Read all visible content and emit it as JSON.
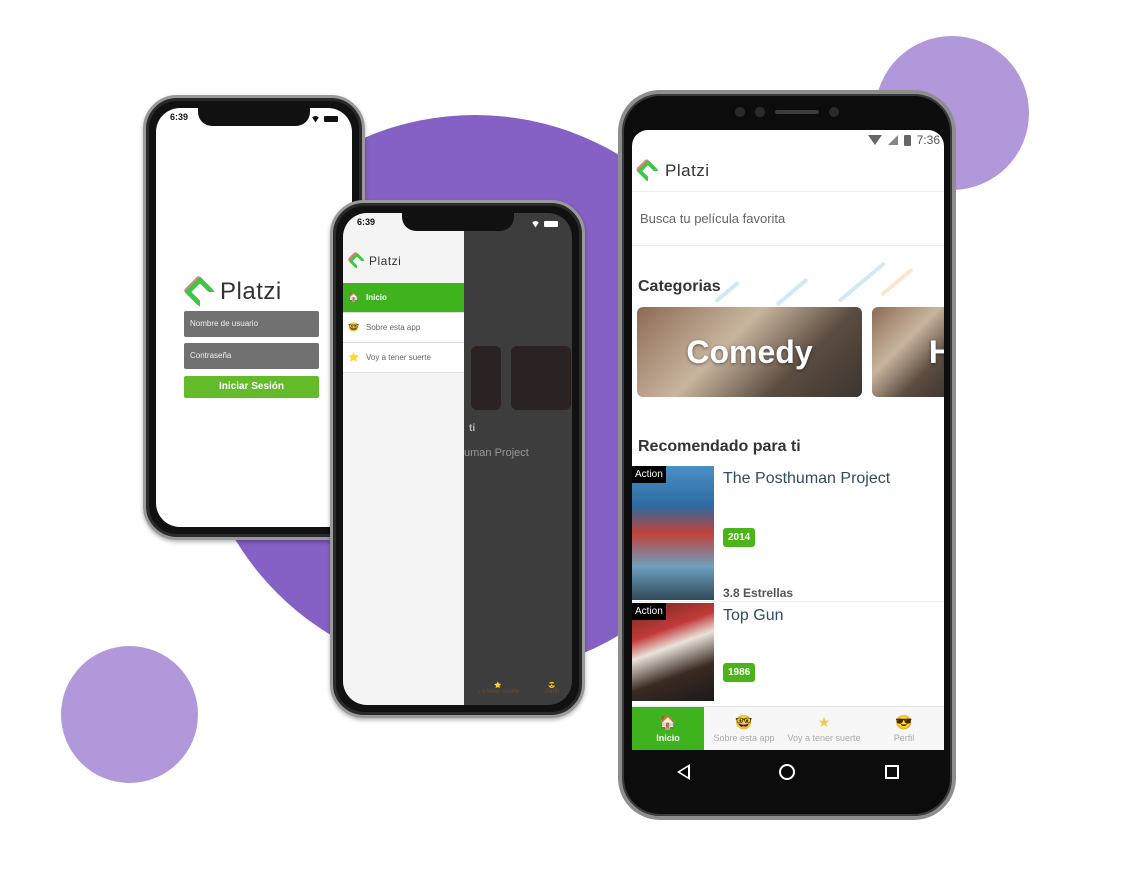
{
  "brand": {
    "name": "Platzi",
    "accent": "#3eb31e",
    "purple": "#8561c5",
    "purple_light": "#b098da"
  },
  "login_screen": {
    "time": "6:39",
    "username_placeholder": "Nombre de usuario",
    "password_placeholder": "Contraseña",
    "login_button": "Iniciar Sesión"
  },
  "drawer_screen": {
    "time": "6:39",
    "menu": [
      {
        "icon": "🏠",
        "label": "Inicio",
        "active": true
      },
      {
        "icon": "🤓",
        "label": "Sobre esta app",
        "active": false
      },
      {
        "icon": "⭐",
        "label": "Voy a tener suerte",
        "active": false
      }
    ],
    "background_text": {
      "section": "ti",
      "movie": "uman Project"
    },
    "background_nav": [
      {
        "icon": "⭐",
        "label": "y a tener suerte"
      },
      {
        "icon": "😎",
        "label": "Perfil"
      }
    ]
  },
  "home_screen": {
    "time": "7:36",
    "search_placeholder": "Busca tu película favorita",
    "categories_title": "Categorias",
    "categories": [
      {
        "label": "Comedy"
      },
      {
        "label": "H"
      }
    ],
    "recommended_title": "Recomendado para ti",
    "movies": [
      {
        "genre": "Action",
        "title": "The Posthuman Project",
        "year": "2014",
        "rating": "3.8 Estrellas"
      },
      {
        "genre": "Action",
        "title": "Top Gun",
        "year": "1986"
      }
    ],
    "bottom_nav": [
      {
        "icon": "🏠",
        "label": "Inicio",
        "active": true
      },
      {
        "icon": "🤓",
        "label": "Sobre esta app",
        "active": false
      },
      {
        "icon": "★",
        "label": "Voy a tener suerte",
        "active": false
      },
      {
        "icon": "😎",
        "label": "Perfil",
        "active": false
      }
    ]
  }
}
